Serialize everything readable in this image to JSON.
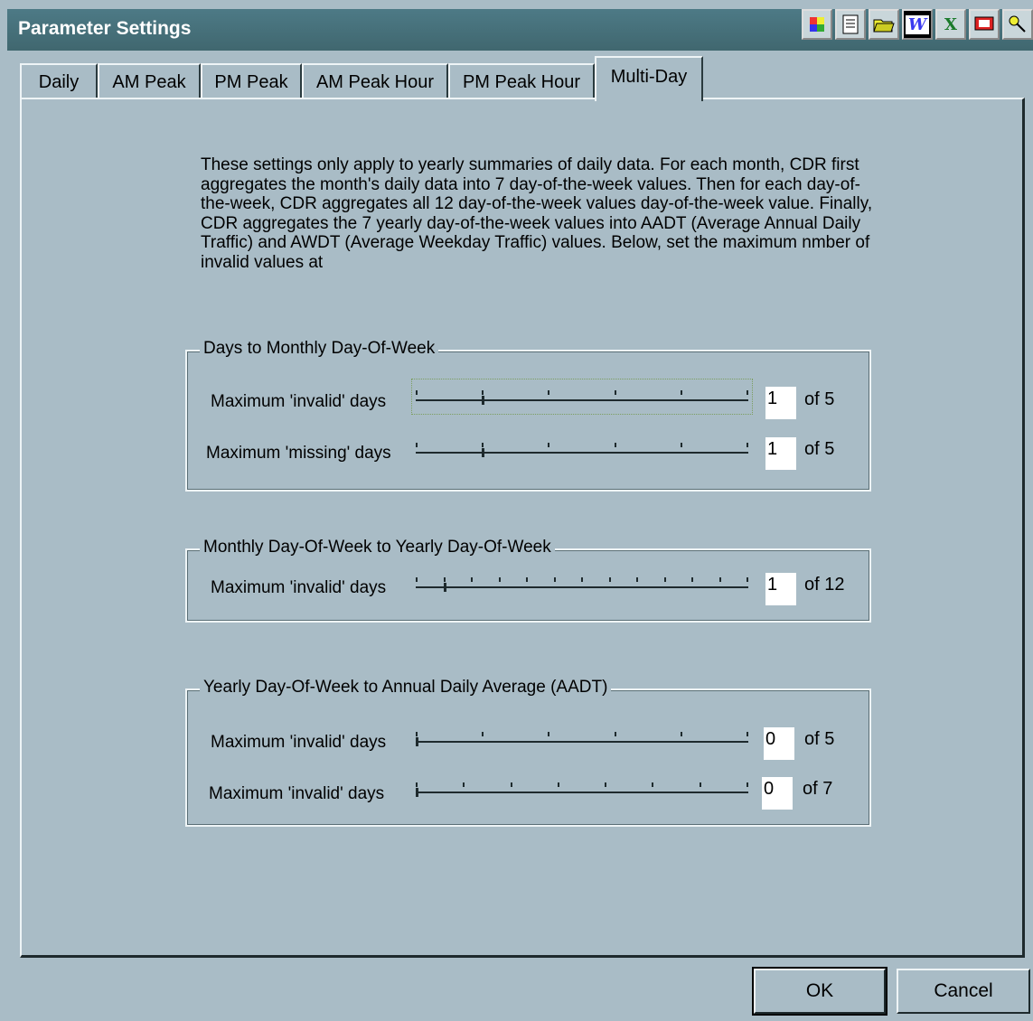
{
  "window": {
    "title": "Parameter Settings"
  },
  "toolbar": {
    "icons": [
      "color-palette-icon",
      "notepad-icon",
      "open-folder-icon",
      "word-icon",
      "excel-icon",
      "screen-icon",
      "key-icon"
    ],
    "word_glyph": "W",
    "excel_glyph": "X"
  },
  "tabs": [
    {
      "label": "Daily",
      "active": false
    },
    {
      "label": "AM Peak",
      "active": false
    },
    {
      "label": "PM Peak",
      "active": false
    },
    {
      "label": "AM Peak Hour",
      "active": false
    },
    {
      "label": "PM Peak Hour",
      "active": false
    },
    {
      "label": "Multi-Day",
      "active": true
    }
  ],
  "description": "These settings only apply to yearly summaries of daily data.  For each month, CDR first aggregates the month's daily data into 7 day-of-the-week values. Then for each day-of-the-week, CDR aggregates all 12 day-of-the-week values day-of-the-week value.  Finally, CDR aggregates the 7 yearly day-of-the-week values into AADT (Average Annual Daily Traffic) and AWDT (Average Weekday Traffic) values.  Below, set the maximum nmber of invalid values at",
  "groups": [
    {
      "title": "Days to Monthly Day-Of-Week",
      "rows": [
        {
          "label": "Maximum 'invalid' days",
          "value": "1",
          "of": "of 5",
          "max": 5,
          "level": 1
        },
        {
          "label": "Maximum 'missing' days",
          "value": "1",
          "of": "of 5",
          "max": 5,
          "level": 1
        }
      ]
    },
    {
      "title": "Monthly Day-Of-Week to Yearly Day-Of-Week",
      "rows": [
        {
          "label": "Maximum 'invalid' days",
          "value": "1",
          "of": "of 12",
          "max": 12,
          "level": 1
        }
      ]
    },
    {
      "title": "Yearly Day-Of-Week to Annual Daily Average (AADT)",
      "rows": [
        {
          "label": "Maximum 'invalid' days",
          "value": "0",
          "of": "of 5",
          "max": 5,
          "level": 0
        },
        {
          "label": "Maximum 'invalid' days",
          "value": "0",
          "of": "of 7",
          "max": 7,
          "level": 0
        }
      ]
    }
  ],
  "buttons": {
    "ok": "OK",
    "cancel": "Cancel"
  }
}
